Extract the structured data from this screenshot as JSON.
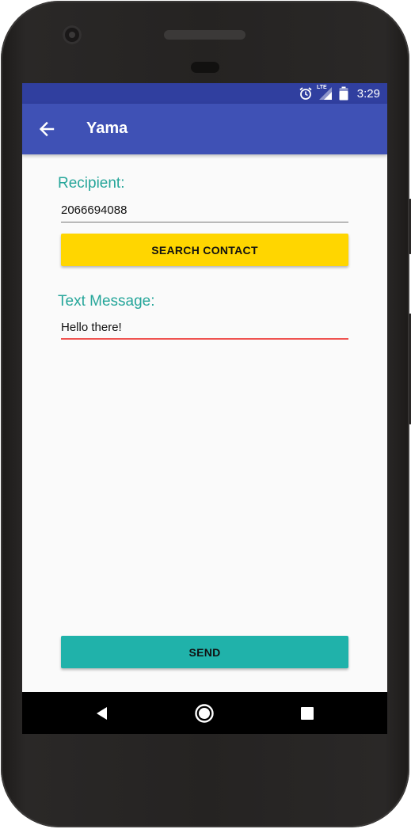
{
  "colors": {
    "status_bar": "#303f9f",
    "app_bar": "#3f51b5",
    "accent": "#26a69a",
    "search_button": "#ffd600",
    "send_button": "#20b2aa",
    "recipient_underline": "#757575",
    "message_underline": "#ef5350"
  },
  "status_bar": {
    "icons": [
      "alarm-icon",
      "lte-signal-icon",
      "battery-icon"
    ],
    "lte_label": "LTE",
    "time": "3:29"
  },
  "app_bar": {
    "back_icon": "arrow-left-icon",
    "title": "Yama"
  },
  "form": {
    "recipient_label": "Recipient:",
    "recipient_value": "2066694088",
    "search_button_label": "SEARCH CONTACT",
    "message_label": "Text Message:",
    "message_value": "Hello there!",
    "send_button_label": "SEND"
  },
  "nav_bar": {
    "icons": [
      "back-triangle-icon",
      "home-circle-icon",
      "recents-square-icon"
    ]
  }
}
